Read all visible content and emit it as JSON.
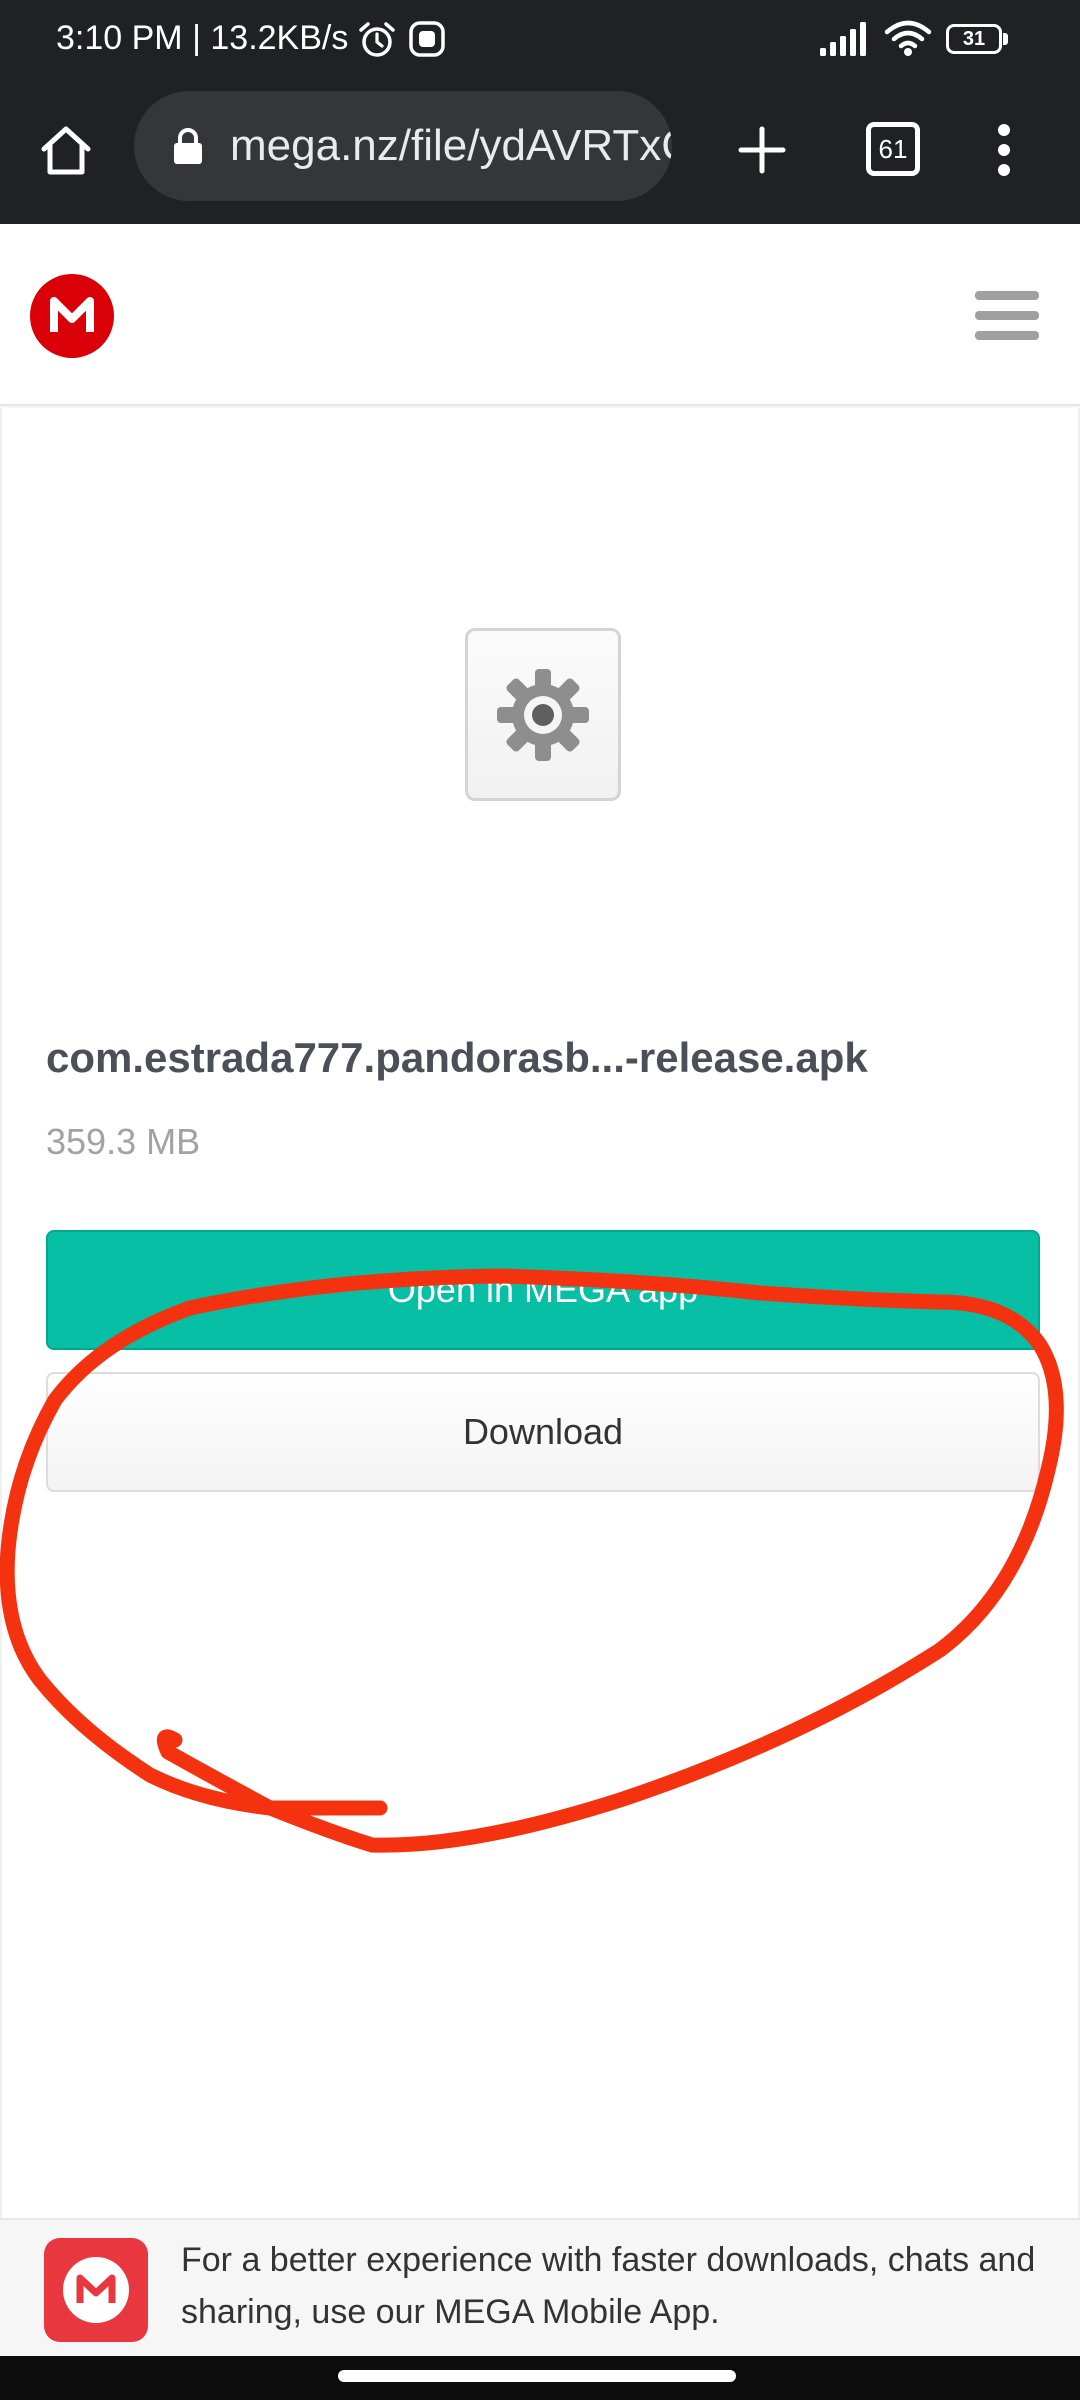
{
  "status_bar": {
    "time": "3:10 PM",
    "separator": "|",
    "network_speed": "13.2KB/s",
    "battery_level": "31",
    "icons": [
      "alarm-icon",
      "app-notification-icon",
      "signal-icon",
      "wifi-icon",
      "battery-icon"
    ]
  },
  "browser": {
    "url": "mega.nz/file/ydAVRTxCP#",
    "tab_count": "61",
    "icons": [
      "home-icon",
      "lock-icon",
      "plus-icon",
      "tabs-icon",
      "more-vert-icon"
    ]
  },
  "site": {
    "logo_letter": "M",
    "brand_color": "#d90007",
    "icons": [
      "mega-logo-icon",
      "hamburger-menu-icon"
    ]
  },
  "file": {
    "name": "com.estrada777.pandorasb...-release.apk",
    "size": "359.3 MB",
    "icon": "settings-gear-icon"
  },
  "actions": {
    "open_in_app_label": "Open in MEGA app",
    "download_label": "Download",
    "open_color": "#07bfa5"
  },
  "annotation": {
    "color": "#f5320f",
    "description_icon": "red-hand-drawn-circle"
  },
  "app_banner": {
    "text": "For a better experience with faster downloads, chats and sharing, use our MEGA Mobile App.",
    "logo_letter": "M",
    "logo_color": "#e8373e"
  }
}
